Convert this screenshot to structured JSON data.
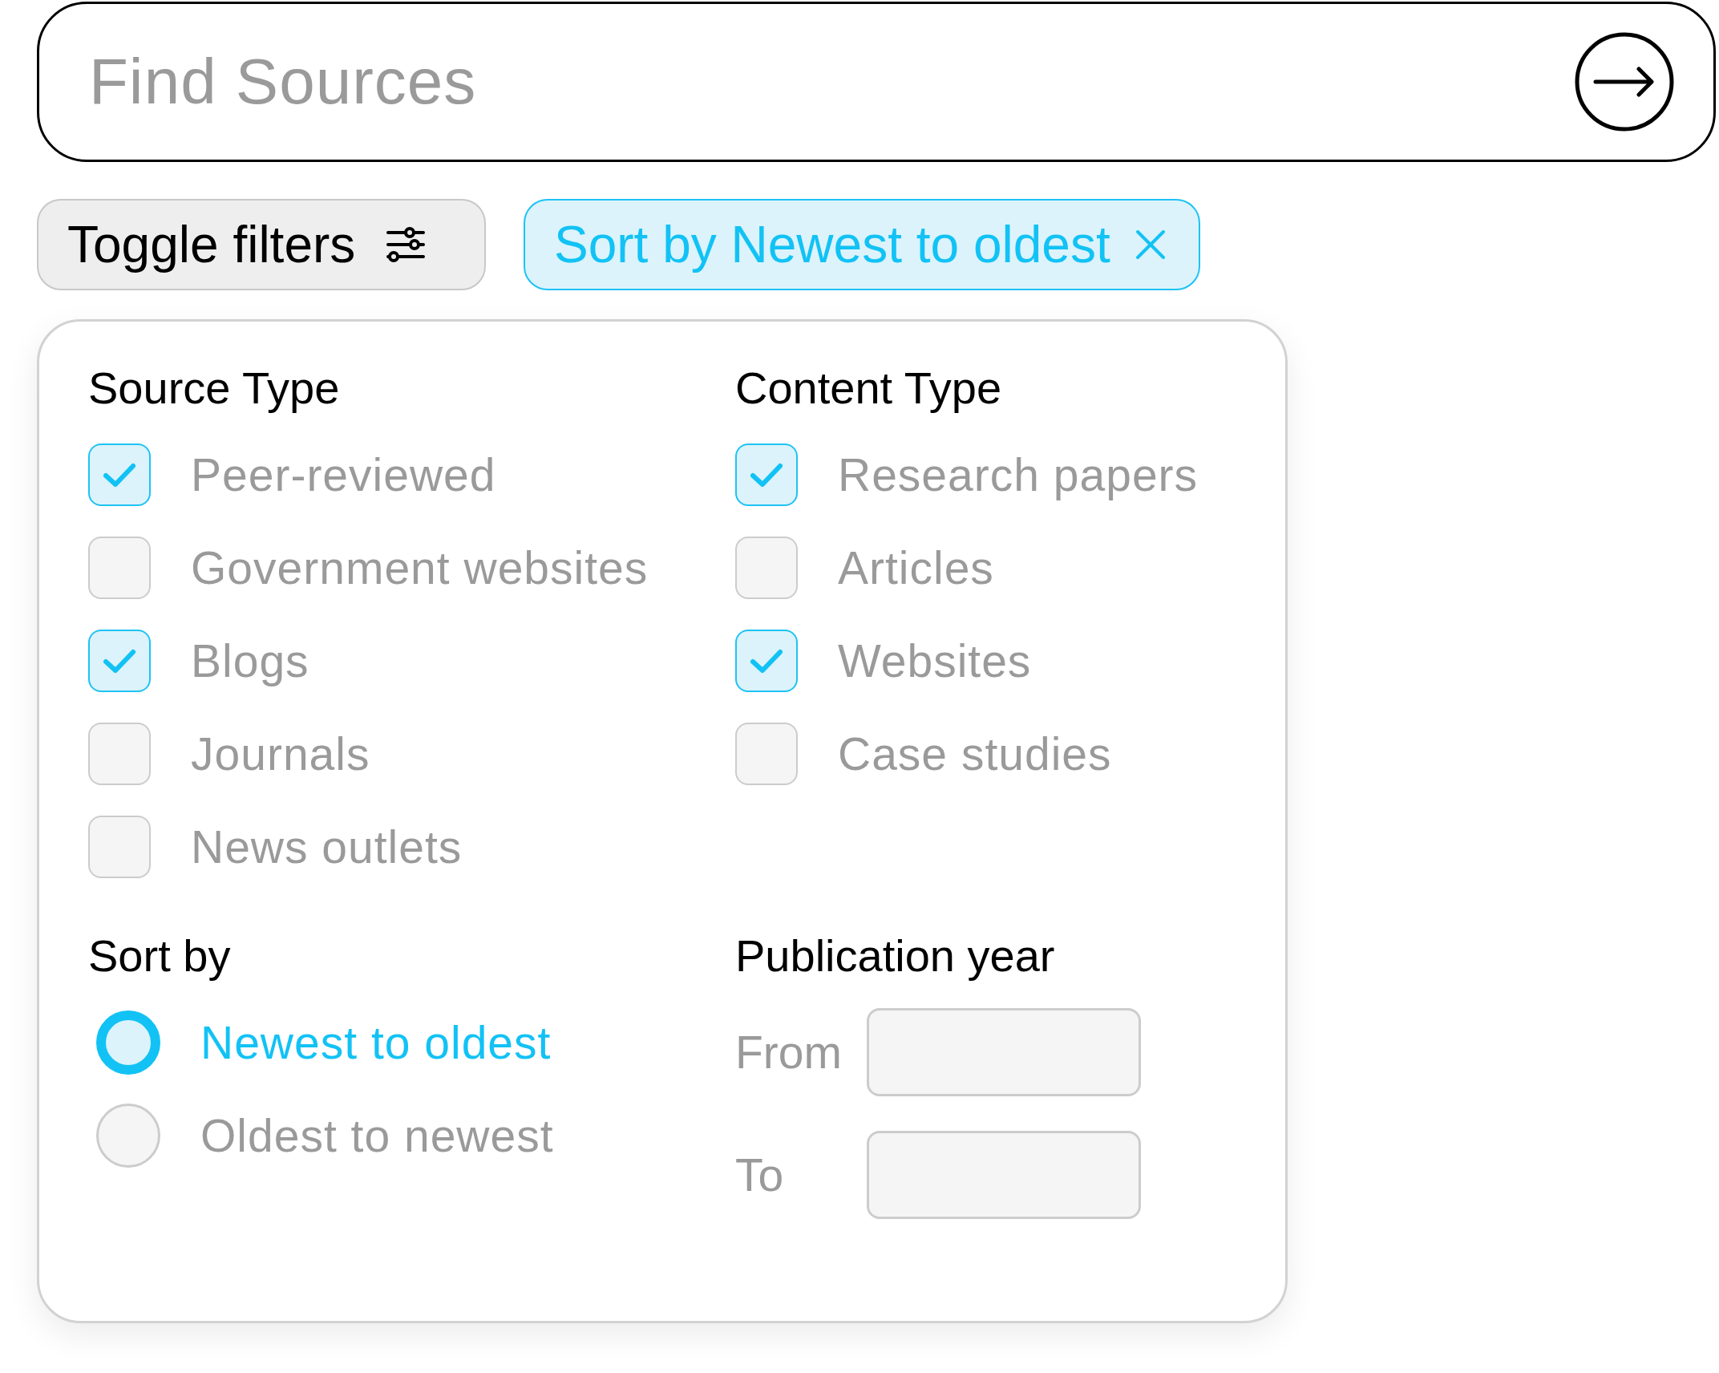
{
  "search": {
    "placeholder": "Find Sources"
  },
  "toggle_button": {
    "label": "Toggle filters"
  },
  "active_sort_chip": {
    "label": "Sort by Newest to oldest"
  },
  "filters": {
    "source_type": {
      "title": "Source Type",
      "options": [
        {
          "label": "Peer-reviewed",
          "checked": true
        },
        {
          "label": "Government websites",
          "checked": false
        },
        {
          "label": "Blogs",
          "checked": true
        },
        {
          "label": "Journals",
          "checked": false
        },
        {
          "label": "News outlets",
          "checked": false
        }
      ]
    },
    "content_type": {
      "title": "Content Type",
      "options": [
        {
          "label": "Research papers",
          "checked": true
        },
        {
          "label": "Articles",
          "checked": false
        },
        {
          "label": "Websites",
          "checked": true
        },
        {
          "label": "Case studies",
          "checked": false
        }
      ]
    },
    "sort_by": {
      "title": "Sort by",
      "options": [
        {
          "label": "Newest to oldest",
          "selected": true
        },
        {
          "label": "Oldest to newest",
          "selected": false
        }
      ]
    },
    "publication_year": {
      "title": "Publication year",
      "fields": [
        {
          "label": "From"
        },
        {
          "label": "To"
        }
      ]
    }
  }
}
